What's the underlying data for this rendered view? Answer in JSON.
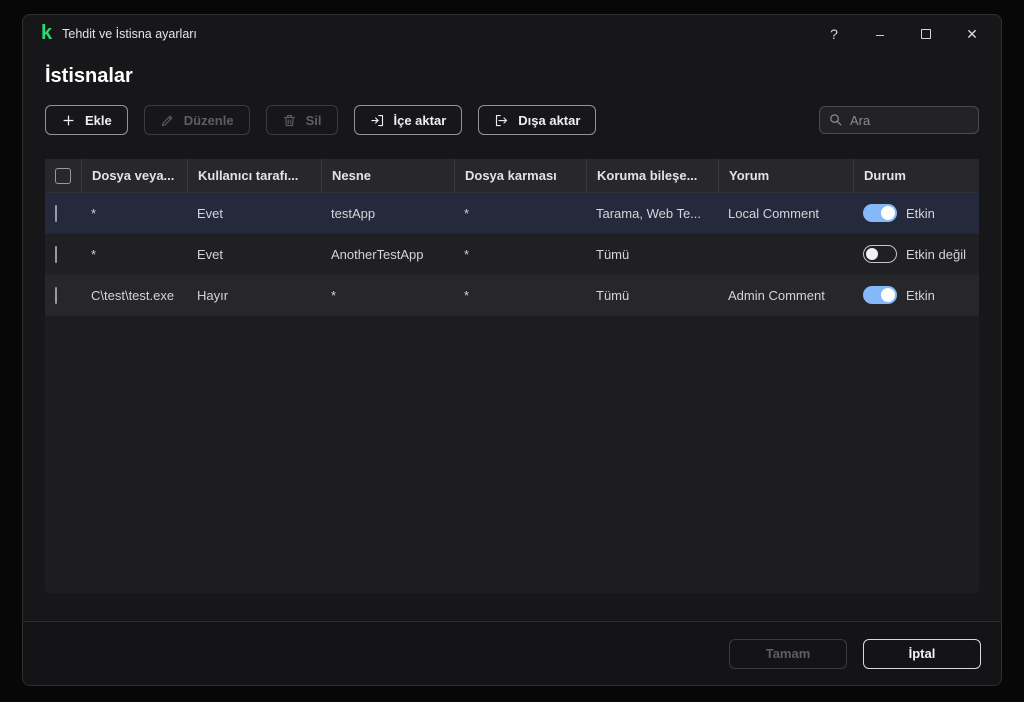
{
  "titlebar": {
    "app_title": "Tehdit ve İstisna ayarları",
    "help": "?",
    "minimize": "–",
    "close": "✕"
  },
  "page": {
    "title": "İstisnalar"
  },
  "toolbar": {
    "add": "Ekle",
    "edit": "Düzenle",
    "delete": "Sil",
    "import": "İçe aktar",
    "export": "Dışa aktar",
    "search_placeholder": "Ara"
  },
  "table": {
    "columns": [
      "Dosya veya...",
      "Kullanıcı tarafı...",
      "Nesne",
      "Dosya karması",
      "Koruma bileşe...",
      "Yorum",
      "Durum"
    ],
    "rows": [
      {
        "file": "*",
        "user": "Evet",
        "object": "testApp",
        "hash": "*",
        "component": "Tarama, Web Te...",
        "comment": "Local Comment",
        "status": "Etkin",
        "enabled": true
      },
      {
        "file": "*",
        "user": "Evet",
        "object": "AnotherTestApp",
        "hash": "*",
        "component": "Tümü",
        "comment": "",
        "status": "Etkin değil",
        "enabled": false
      },
      {
        "file": "C\\test\\test.exe",
        "user": "Hayır",
        "object": "*",
        "hash": "*",
        "component": "Tümü",
        "comment": "Admin Comment",
        "status": "Etkin",
        "enabled": true
      }
    ]
  },
  "footer": {
    "ok": "Tamam",
    "cancel": "İptal"
  },
  "colors": {
    "brand_green": "#2bd96e",
    "toggle_on_blue": "#85b8f8"
  }
}
